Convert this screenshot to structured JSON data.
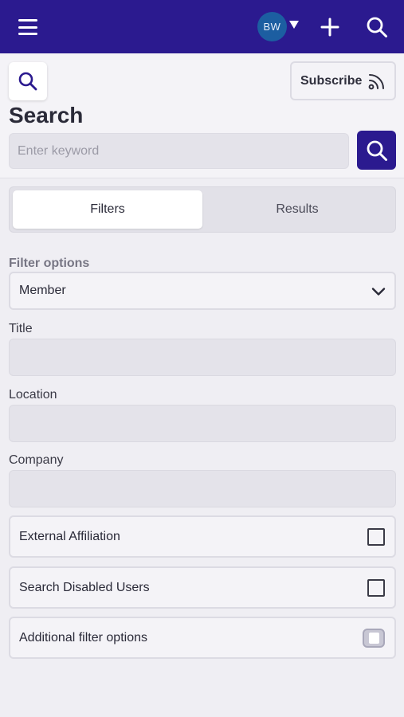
{
  "topbar": {
    "menu_icon": "hamburger-menu-icon",
    "avatar_initials": "BW",
    "avatar_color": "#1c5ea1",
    "caret_icon": "caret-down-icon",
    "add_icon": "plus-icon",
    "search_icon": "search-icon",
    "background_color": "#2b1a8f"
  },
  "header": {
    "search_toggle_icon": "search-icon",
    "subscribe_label": "Subscribe",
    "subscribe_icon": "rss-icon",
    "title": "Search",
    "keyword_placeholder": "Enter keyword",
    "keyword_value": "",
    "search_button_icon": "search-icon"
  },
  "tabs": [
    {
      "label": "Filters",
      "active": true
    },
    {
      "label": "Results",
      "active": false
    }
  ],
  "filters": {
    "filter_options_label": "Filter options",
    "filter_options_value": "Member",
    "title_label": "Title",
    "title_value": "",
    "location_label": "Location",
    "location_value": "",
    "company_label": "Company",
    "company_value": "",
    "external_affiliation_label": "External Affiliation",
    "external_affiliation_checked": false,
    "search_disabled_label": "Search Disabled Users",
    "search_disabled_checked": false,
    "additional_label": "Additional filter options",
    "additional_enabled": false
  }
}
